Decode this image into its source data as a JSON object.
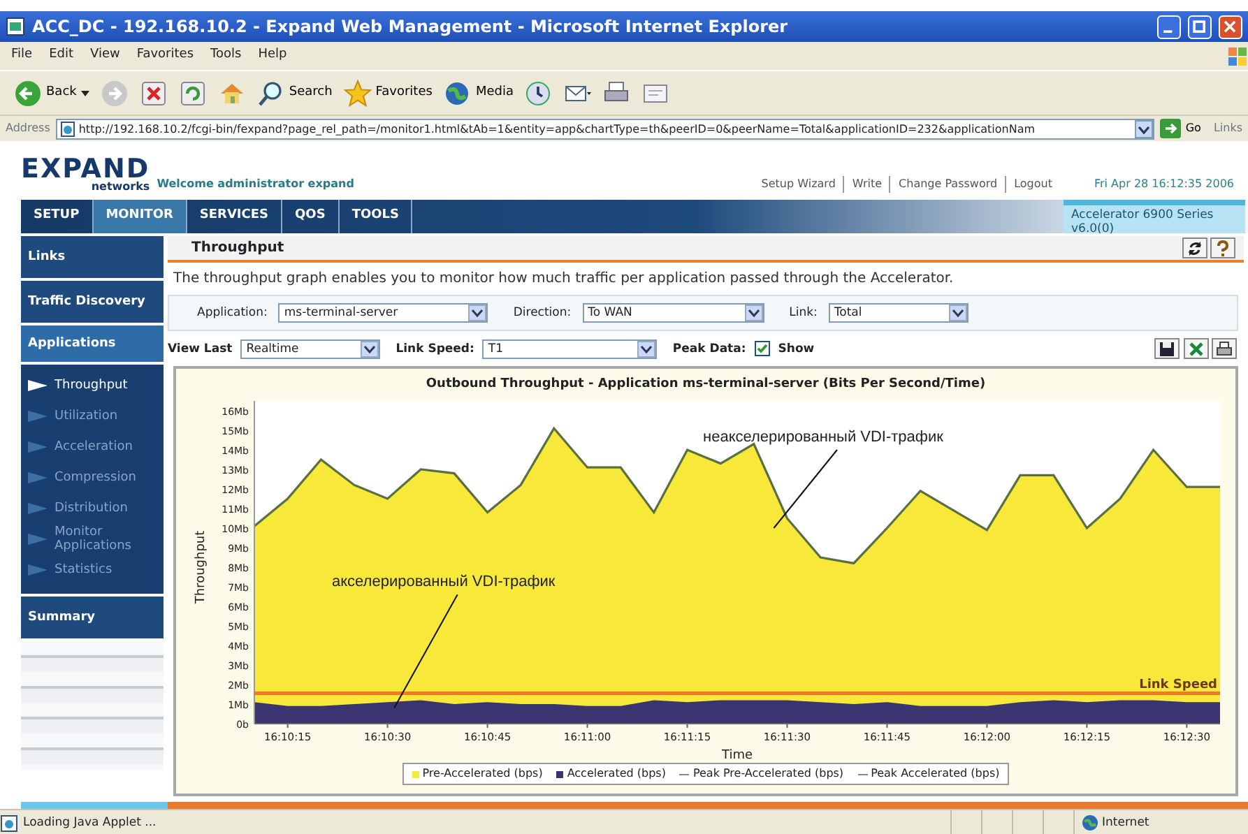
{
  "window": {
    "title": "ACC_DC - 192.168.10.2 - Expand Web Management - Microsoft Internet Explorer"
  },
  "menu_bar": [
    "File",
    "Edit",
    "View",
    "Favorites",
    "Tools",
    "Help"
  ],
  "toolbar": [
    {
      "kind": "back",
      "label": "Back"
    },
    {
      "kind": "forward"
    },
    {
      "kind": "stop"
    },
    {
      "kind": "refresh"
    },
    {
      "kind": "home"
    },
    {
      "kind": "search",
      "label": "Search"
    },
    {
      "kind": "favorites",
      "label": "Favorites"
    },
    {
      "kind": "media",
      "label": "Media"
    },
    {
      "kind": "history"
    },
    {
      "kind": "mail"
    },
    {
      "kind": "print"
    },
    {
      "kind": "edit"
    }
  ],
  "address_bar": {
    "label": "Address",
    "url": "http://192.168.10.2/fcgi-bin/fexpand?page_rel_path=/monitor1.html&tAb=1&entity=app&chartType=th&peerID=0&peerName=Total&applicationID=232&applicationNam",
    "go": "Go",
    "links": "Links"
  },
  "header": {
    "logo": "EXPAND",
    "logo_sub": "networks",
    "welcome": "Welcome administrator expand",
    "links": [
      "Setup Wizard",
      "Write",
      "Change Password",
      "Logout"
    ],
    "datetime": "Fri Apr 28 16:12:35 2006"
  },
  "nav_tabs": [
    {
      "label": "SETUP",
      "selected": false
    },
    {
      "label": "MONITOR",
      "selected": true
    },
    {
      "label": "SERVICES",
      "selected": false
    },
    {
      "label": "QOS",
      "selected": false
    },
    {
      "label": "TOOLS",
      "selected": false
    }
  ],
  "product": {
    "name": "Accelerator 6900 Series",
    "version": "v6.0(0)"
  },
  "sidebar": {
    "items": [
      {
        "label": "Links",
        "expanded": false
      },
      {
        "label": "Traffic Discovery",
        "expanded": false
      },
      {
        "label": "Applications",
        "expanded": true,
        "children": [
          {
            "label": "Throughput",
            "selected": true
          },
          {
            "label": "Utilization",
            "selected": false
          },
          {
            "label": "Acceleration",
            "selected": false
          },
          {
            "label": "Compression",
            "selected": false
          },
          {
            "label": "Distribution",
            "selected": false
          },
          {
            "label": "Monitor Applications",
            "selected": false
          },
          {
            "label": "Statistics",
            "selected": false
          }
        ]
      },
      {
        "label": "Summary",
        "expanded": false
      }
    ]
  },
  "panel": {
    "title": "Throughput",
    "description": "The throughput graph enables you to monitor how much traffic per application passed through the Accelerator.",
    "filters": [
      {
        "label": "Application:",
        "value": "ms-terminal-server"
      },
      {
        "label": "Direction:",
        "value": "To WAN"
      },
      {
        "label": "Link:",
        "value": "Total"
      }
    ],
    "options": [
      {
        "label": "View Last",
        "value": "Realtime"
      },
      {
        "label": "Link Speed:",
        "value": "T1"
      }
    ],
    "peak_data": {
      "label": "Peak Data:",
      "checked": true,
      "text": "Show"
    },
    "chart_data": {
      "type": "area",
      "title": "Outbound  Throughput - Application ms-terminal-server (Bits Per Second/Time)",
      "xlabel": "Time",
      "ylabel": "Throughput",
      "stacked": false,
      "categories": [
        null,
        "16:10:15",
        null,
        null,
        "16:10:30",
        null,
        null,
        "16:10:45",
        null,
        null,
        "16:11:00",
        null,
        null,
        "16:11:15",
        null,
        null,
        "16:11:30",
        null,
        null,
        "16:11:45",
        null,
        null,
        "16:12:00",
        null,
        null,
        "16:12:15",
        null,
        null,
        "16:12:30",
        null
      ],
      "series": [
        {
          "name": "Pre-Accelerated (bps)",
          "color": "#f7e83a",
          "values": [
            10.1,
            11.5,
            13.5,
            12.2,
            11.5,
            13.0,
            12.8,
            10.8,
            12.2,
            15.1,
            13.1,
            13.1,
            10.8,
            14.0,
            13.3,
            14.3,
            10.5,
            8.5,
            8.2,
            10.0,
            11.9,
            10.9,
            9.9,
            12.7,
            12.7,
            10.0,
            11.5,
            14.0,
            12.1,
            12.1
          ]
        },
        {
          "name": "Accelerated (bps)",
          "color": "#3a3470",
          "values": [
            1.1,
            0.9,
            0.9,
            1.0,
            1.1,
            1.2,
            1.0,
            1.1,
            1.0,
            1.0,
            0.9,
            0.9,
            1.2,
            1.1,
            1.2,
            1.2,
            1.2,
            1.1,
            1.0,
            1.1,
            0.9,
            0.9,
            0.9,
            1.1,
            1.2,
            1.1,
            1.2,
            1.2,
            1.1,
            1.1
          ]
        }
      ],
      "ylim": [
        0,
        16.5
      ],
      "yticks": [
        {
          "value": 0,
          "label": "0b"
        },
        {
          "value": 1,
          "label": "1Mb"
        },
        {
          "value": 2,
          "label": "2Mb"
        },
        {
          "value": 3,
          "label": "3Mb"
        },
        {
          "value": 4,
          "label": "4Mb"
        },
        {
          "value": 5,
          "label": "5Mb"
        },
        {
          "value": 6,
          "label": "6Mb"
        },
        {
          "value": 7,
          "label": "7Mb"
        },
        {
          "value": 8,
          "label": "8Mb"
        },
        {
          "value": 9,
          "label": "9Mb"
        },
        {
          "value": 10,
          "label": "10Mb"
        },
        {
          "value": 11,
          "label": "11Mb"
        },
        {
          "value": 12,
          "label": "12Mb"
        },
        {
          "value": 13,
          "label": "13Mb"
        },
        {
          "value": 14,
          "label": "14Mb"
        },
        {
          "value": 15,
          "label": "15Mb"
        },
        {
          "value": 16,
          "label": "16Mb"
        }
      ],
      "legend": "bottom",
      "ref_lines": [
        {
          "axis": "y",
          "value": 1.55,
          "label": "Link Speed",
          "color": "#f07828"
        }
      ],
      "annotations": [
        "неакселерированный VDI-трафик",
        "акселерированный VDI-трафик"
      ]
    },
    "legend": [
      {
        "kind": "line",
        "label": "Peak Pre-Accelerated (bps)",
        "color": "#8a8a8a"
      },
      {
        "kind": "line",
        "label": "Peak Accelerated (bps)",
        "color": "#8a8a8a"
      }
    ]
  },
  "status_bar": {
    "text": "Loading Java Applet ...",
    "zone": "Internet"
  }
}
